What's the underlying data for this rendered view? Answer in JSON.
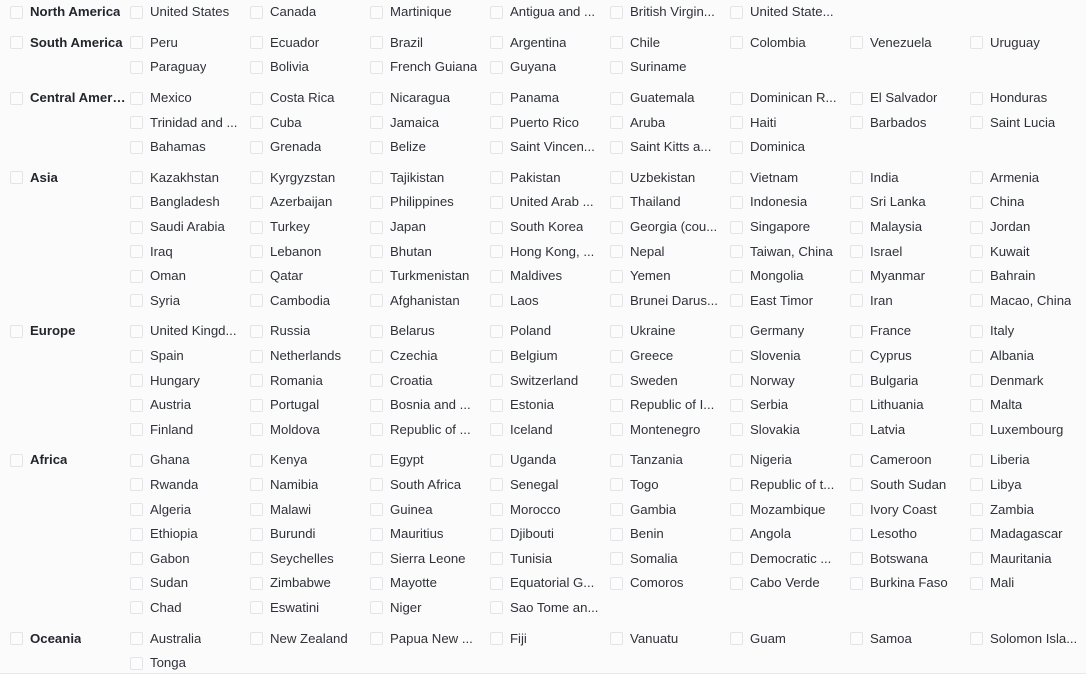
{
  "panel": {
    "name": "region-country-checkbox-selector",
    "background_color": "#fbfbfc",
    "checkbox_border_color": "#e3e4e8",
    "text_color": "#2f3238",
    "columns": 9,
    "all_unchecked": true
  },
  "regions": [
    {
      "label": "North America",
      "checked": false,
      "rows": [
        [
          "United States",
          "Canada",
          "Martinique",
          "Antigua and ...",
          "British Virgin...",
          "United State...",
          "",
          ""
        ]
      ]
    },
    {
      "label": "South America",
      "checked": false,
      "rows": [
        [
          "Peru",
          "Ecuador",
          "Brazil",
          "Argentina",
          "Chile",
          "Colombia",
          "Venezuela",
          "Uruguay"
        ],
        [
          "Paraguay",
          "Bolivia",
          "French Guiana",
          "Guyana",
          "Suriname",
          "",
          "",
          ""
        ]
      ]
    },
    {
      "label": "Central Ameri...",
      "checked": false,
      "rows": [
        [
          "Mexico",
          "Costa Rica",
          "Nicaragua",
          "Panama",
          "Guatemala",
          "Dominican R...",
          "El Salvador",
          "Honduras"
        ],
        [
          "Trinidad and ...",
          "Cuba",
          "Jamaica",
          "Puerto Rico",
          "Aruba",
          "Haiti",
          "Barbados",
          "Saint Lucia"
        ],
        [
          "Bahamas",
          "Grenada",
          "Belize",
          "Saint Vincen...",
          "Saint Kitts a...",
          "Dominica",
          "",
          ""
        ]
      ]
    },
    {
      "label": "Asia",
      "checked": false,
      "rows": [
        [
          "Kazakhstan",
          "Kyrgyzstan",
          "Tajikistan",
          "Pakistan",
          "Uzbekistan",
          "Vietnam",
          "India",
          "Armenia"
        ],
        [
          "Bangladesh",
          "Azerbaijan",
          "Philippines",
          "United Arab ...",
          "Thailand",
          "Indonesia",
          "Sri Lanka",
          "China"
        ],
        [
          "Saudi Arabia",
          "Turkey",
          "Japan",
          "South Korea",
          "Georgia (cou...",
          "Singapore",
          "Malaysia",
          "Jordan"
        ],
        [
          "Iraq",
          "Lebanon",
          "Bhutan",
          "Hong Kong, ...",
          "Nepal",
          "Taiwan, China",
          "Israel",
          "Kuwait"
        ],
        [
          "Oman",
          "Qatar",
          "Turkmenistan",
          "Maldives",
          "Yemen",
          "Mongolia",
          "Myanmar",
          "Bahrain"
        ],
        [
          "Syria",
          "Cambodia",
          "Afghanistan",
          "Laos",
          "Brunei Darus...",
          "East Timor",
          "Iran",
          "Macao, China"
        ]
      ]
    },
    {
      "label": "Europe",
      "checked": false,
      "rows": [
        [
          "United Kingd...",
          "Russia",
          "Belarus",
          "Poland",
          "Ukraine",
          "Germany",
          "France",
          "Italy"
        ],
        [
          "Spain",
          "Netherlands",
          "Czechia",
          "Belgium",
          "Greece",
          "Slovenia",
          "Cyprus",
          "Albania"
        ],
        [
          "Hungary",
          "Romania",
          "Croatia",
          "Switzerland",
          "Sweden",
          "Norway",
          "Bulgaria",
          "Denmark"
        ],
        [
          "Austria",
          "Portugal",
          "Bosnia and ...",
          "Estonia",
          "Republic of I...",
          "Serbia",
          "Lithuania",
          "Malta"
        ],
        [
          "Finland",
          "Moldova",
          "Republic of ...",
          "Iceland",
          "Montenegro",
          "Slovakia",
          "Latvia",
          "Luxembourg"
        ]
      ]
    },
    {
      "label": "Africa",
      "checked": false,
      "rows": [
        [
          "Ghana",
          "Kenya",
          "Egypt",
          "Uganda",
          "Tanzania",
          "Nigeria",
          "Cameroon",
          "Liberia"
        ],
        [
          "Rwanda",
          "Namibia",
          "South Africa",
          "Senegal",
          "Togo",
          "Republic of t...",
          "South Sudan",
          "Libya"
        ],
        [
          "Algeria",
          "Malawi",
          "Guinea",
          "Morocco",
          "Gambia",
          "Mozambique",
          "Ivory Coast",
          "Zambia"
        ],
        [
          "Ethiopia",
          "Burundi",
          "Mauritius",
          "Djibouti",
          "Benin",
          "Angola",
          "Lesotho",
          "Madagascar"
        ],
        [
          "Gabon",
          "Seychelles",
          "Sierra Leone",
          "Tunisia",
          "Somalia",
          "Democratic ...",
          "Botswana",
          "Mauritania"
        ],
        [
          "Sudan",
          "Zimbabwe",
          "Mayotte",
          "Equatorial G...",
          "Comoros",
          "Cabo Verde",
          "Burkina Faso",
          "Mali"
        ],
        [
          "Chad",
          "Eswatini",
          "Niger",
          "Sao Tome an...",
          "",
          "",
          "",
          ""
        ]
      ]
    },
    {
      "label": "Oceania",
      "checked": false,
      "rows": [
        [
          "Australia",
          "New Zealand",
          "Papua New ...",
          "Fiji",
          "Vanuatu",
          "Guam",
          "Samoa",
          "Solomon Isla..."
        ],
        [
          "Tonga",
          "",
          "",
          "",
          "",
          "",
          "",
          ""
        ]
      ]
    }
  ]
}
